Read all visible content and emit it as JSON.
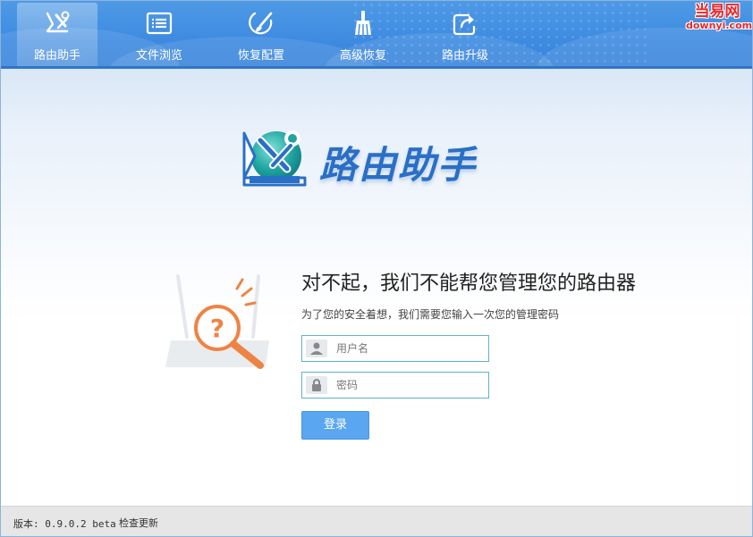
{
  "watermark": {
    "top": "当易网",
    "bottom": "downyi.com"
  },
  "toolbar": {
    "tabs": [
      {
        "label": "路由助手",
        "icon": "router-tools-icon",
        "active": true
      },
      {
        "label": "文件浏览",
        "icon": "file-list-icon",
        "active": false
      },
      {
        "label": "恢复配置",
        "icon": "restore-brush-icon",
        "active": false
      },
      {
        "label": "高级恢复",
        "icon": "broom-icon",
        "active": false
      },
      {
        "label": "路由升级",
        "icon": "upgrade-share-icon",
        "active": false
      }
    ]
  },
  "logo": {
    "text": "路由助手",
    "icon": "router-wrench-logo-icon"
  },
  "message": {
    "headline": "对不起，我们不能帮您管理您的路由器",
    "subline": "为了您的安全着想，我们需要您输入一次您的管理密码"
  },
  "form": {
    "username": {
      "placeholder": "用户名",
      "value": "",
      "icon": "user-icon"
    },
    "password": {
      "placeholder": "密码",
      "value": "",
      "icon": "lock-icon"
    },
    "login_label": "登录"
  },
  "status": {
    "version_text": "版本: 0.9.0.2 beta",
    "update_label": "检查更新"
  },
  "colors": {
    "toolbar": "#3d8ae0",
    "logo_text": "#2a6fc6",
    "accent_orange": "#ee8444",
    "field_border": "#5fb2c9",
    "button": "#5aa6f0"
  }
}
